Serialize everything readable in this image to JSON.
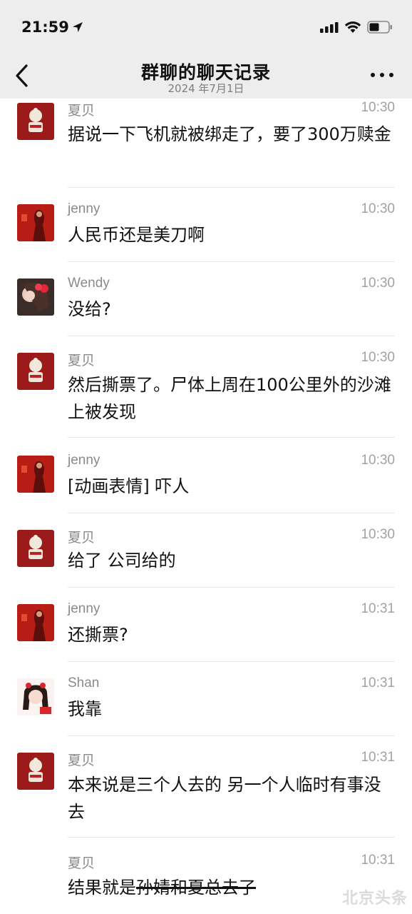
{
  "status_bar": {
    "time": "21:59"
  },
  "header": {
    "title": "群聊的聊天记录",
    "date": "2024 年7月1日"
  },
  "messages": [
    {
      "sender": "夏贝",
      "avatar": "doll-avatar",
      "time": "10:30",
      "text": "据说一下飞机就被绑走了，要了300万赎金"
    },
    {
      "sender": "jenny",
      "avatar": "red-woman-avatar",
      "time": "10:30",
      "text": "人民币还是美刀啊"
    },
    {
      "sender": "Wendy",
      "avatar": "wendy-photo-avatar",
      "time": "10:30",
      "text": "没给?"
    },
    {
      "sender": "夏贝",
      "avatar": "doll-avatar",
      "time": "10:30",
      "text": "然后撕票了。尸体上周在100公里外的沙滩上被发现"
    },
    {
      "sender": "jenny",
      "avatar": "red-woman-avatar",
      "time": "10:30",
      "text": "[动画表情] 吓人"
    },
    {
      "sender": "夏贝",
      "avatar": "doll-avatar",
      "time": "10:30",
      "text": "给了 公司给的"
    },
    {
      "sender": "jenny",
      "avatar": "red-woman-avatar",
      "time": "10:31",
      "text": "还撕票?"
    },
    {
      "sender": "Shan",
      "avatar": "cartoon-girl-avatar",
      "time": "10:31",
      "text": "我靠"
    },
    {
      "sender": "夏贝",
      "avatar": "doll-avatar",
      "time": "10:31",
      "text": "本来说是三个人去的 另一个人临时有事没去"
    },
    {
      "sender": "夏贝",
      "avatar": "none",
      "time": "10:31",
      "text_plain": "结果就是",
      "text_struck": "孙婧和夏总去了"
    }
  ],
  "watermark": "北京头条"
}
